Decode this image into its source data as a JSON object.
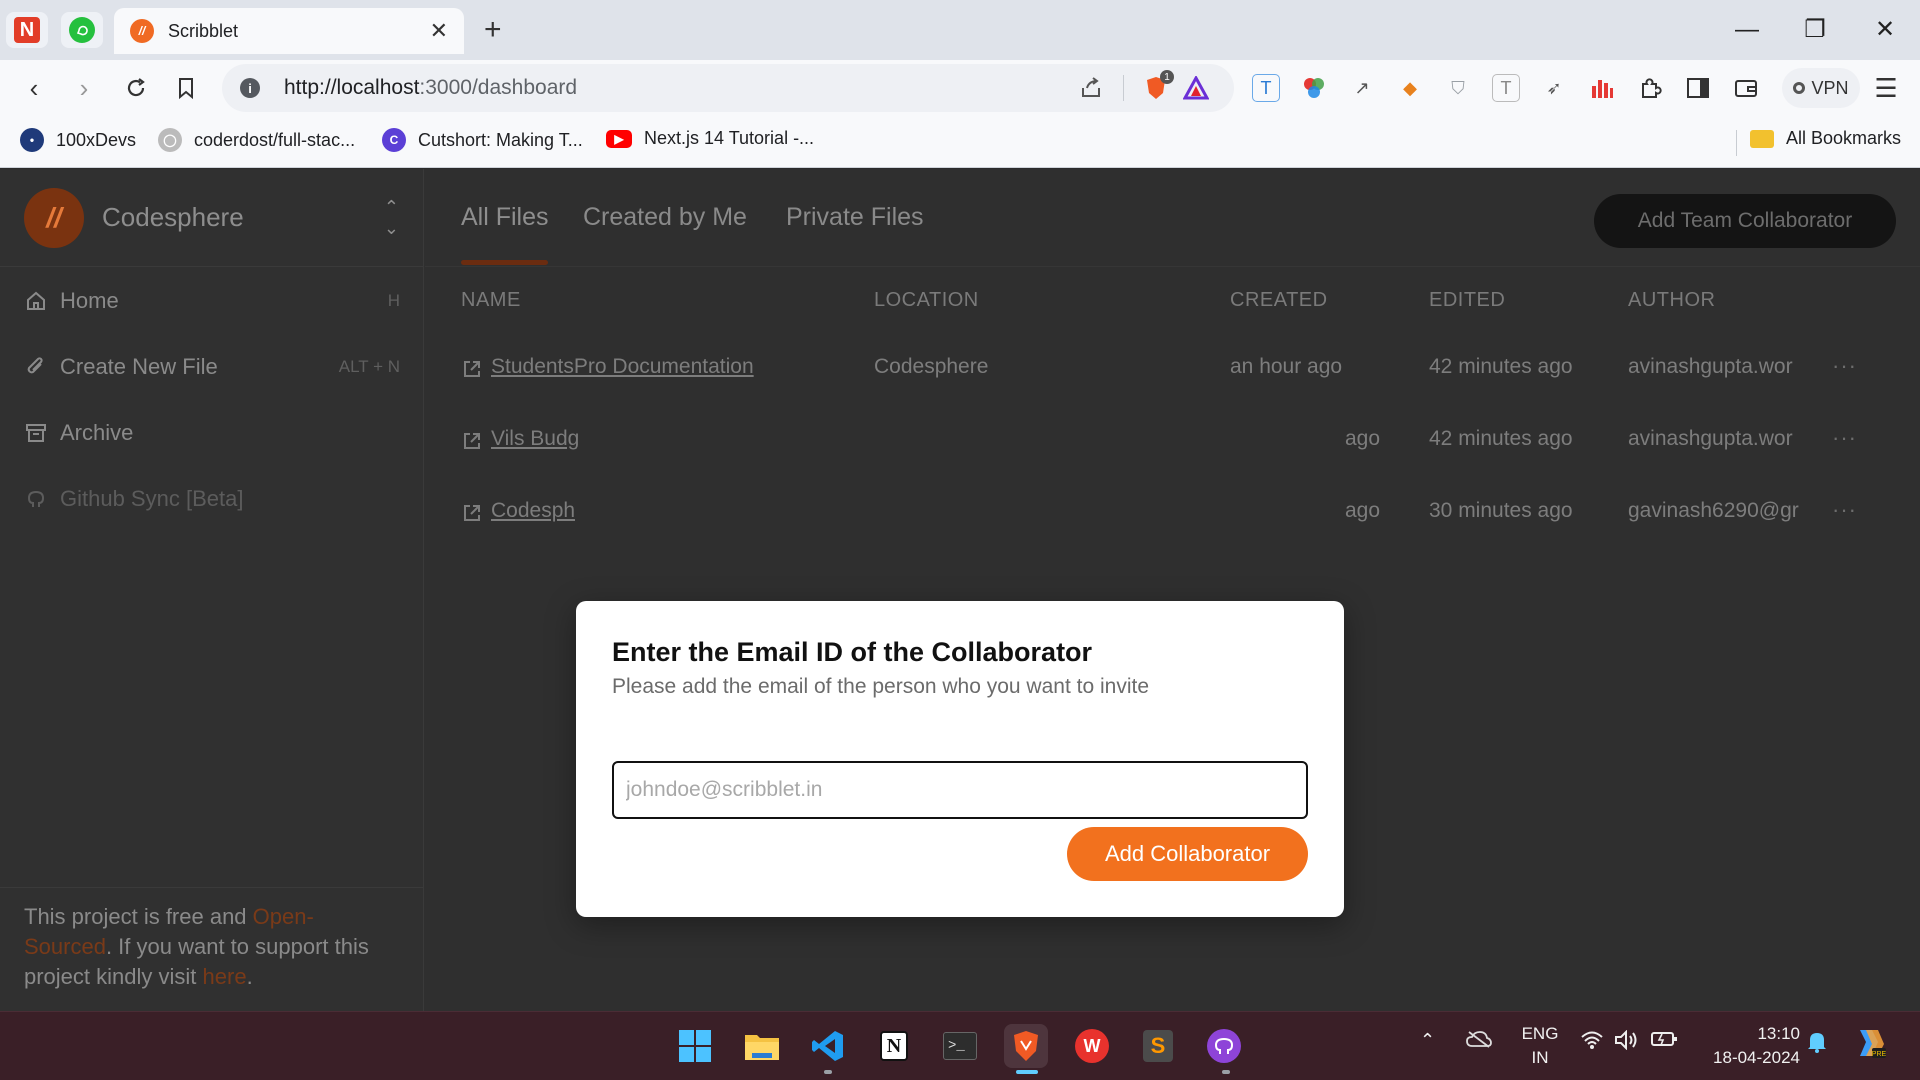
{
  "browser": {
    "tab_title": "Scribblet",
    "favicon_text": "//",
    "new_tab": "+",
    "url_host": "http://localhost",
    "url_path": ":3000/dashboard",
    "vpn_label": "VPN",
    "brave_badge": "1",
    "bookmarks": [
      {
        "label": "100xDevs"
      },
      {
        "label": "coderdost/full-stac..."
      },
      {
        "label": "Cutshort: Making T..."
      },
      {
        "label": "Next.js 14 Tutorial -..."
      }
    ],
    "all_bookmarks": "All Bookmarks"
  },
  "sidebar": {
    "logo_text": "//",
    "workspace_name": "Codesphere",
    "items": [
      {
        "label": "Home",
        "shortcut": "H"
      },
      {
        "label": "Create New File",
        "shortcut": "ALT + N"
      },
      {
        "label": "Archive",
        "shortcut": ""
      },
      {
        "label": "Github Sync [Beta]",
        "shortcut": ""
      }
    ],
    "footer": {
      "part1": "This project is free and ",
      "link1": "Open-Sourced",
      "part2": ". If you want to support this project kindly visit ",
      "link2": "here",
      "part3": "."
    }
  },
  "main": {
    "tabs": [
      "All Files",
      "Created by Me",
      "Private Files"
    ],
    "add_team_button": "Add Team Collaborator",
    "columns": [
      "NAME",
      "LOCATION",
      "CREATED",
      "EDITED",
      "AUTHOR"
    ],
    "rows": [
      {
        "name": "StudentsPro Documentation",
        "location": "Codesphere",
        "created": "an hour ago",
        "edited": "42 minutes ago",
        "author": "avinashgupta.wor"
      },
      {
        "name": "Vils Budg",
        "location": "",
        "created": "ago",
        "edited": "42 minutes ago",
        "author": "avinashgupta.wor"
      },
      {
        "name": "Codesph",
        "location": "",
        "created": "ago",
        "edited": "30 minutes ago",
        "author": "gavinash6290@gr"
      }
    ],
    "row_menu": "···"
  },
  "modal": {
    "title": "Enter the Email ID of the Collaborator",
    "subtitle": "Please add the email of the person who you want to invite",
    "input_placeholder": "johndoe@scribblet.in",
    "input_value": "",
    "button": "Add Collaborator"
  },
  "taskbar": {
    "lang_top": "ENG",
    "lang_bottom": "IN",
    "time": "13:10",
    "date": "18-04-2024"
  },
  "colors": {
    "accent": "#f2711e",
    "sidebar_link": "#7a3a18",
    "modal_bg": "#ffffff"
  }
}
